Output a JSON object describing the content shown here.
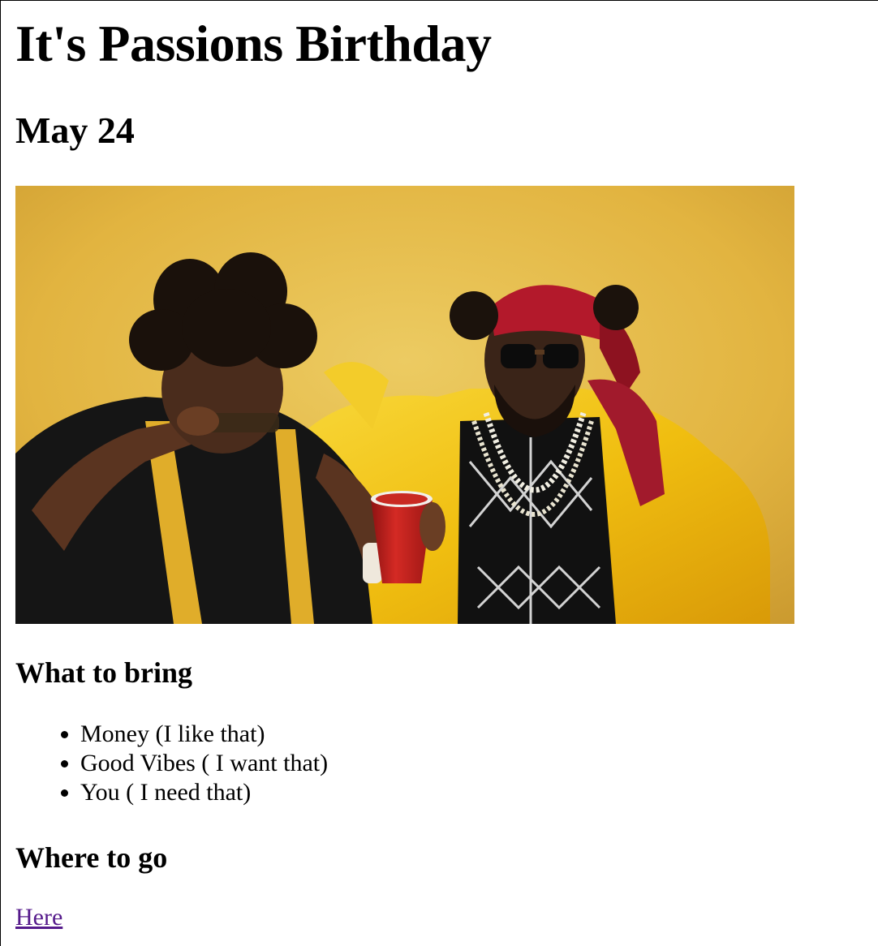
{
  "page": {
    "title": "It's Passions Birthday",
    "date": "May 24"
  },
  "image": {
    "description": "photo",
    "colors": {
      "background": "#e5b63e",
      "jacket": "#f2c21a",
      "cup": "#c8201e",
      "bandana": "#b01c2a"
    }
  },
  "bring": {
    "heading": "What to bring",
    "items": [
      "Money (I like that)",
      "Good Vibes ( I want that)",
      "You ( I need that)"
    ]
  },
  "go": {
    "heading": "Where to go",
    "link_text": "Here",
    "link_color": "#551a8b"
  }
}
